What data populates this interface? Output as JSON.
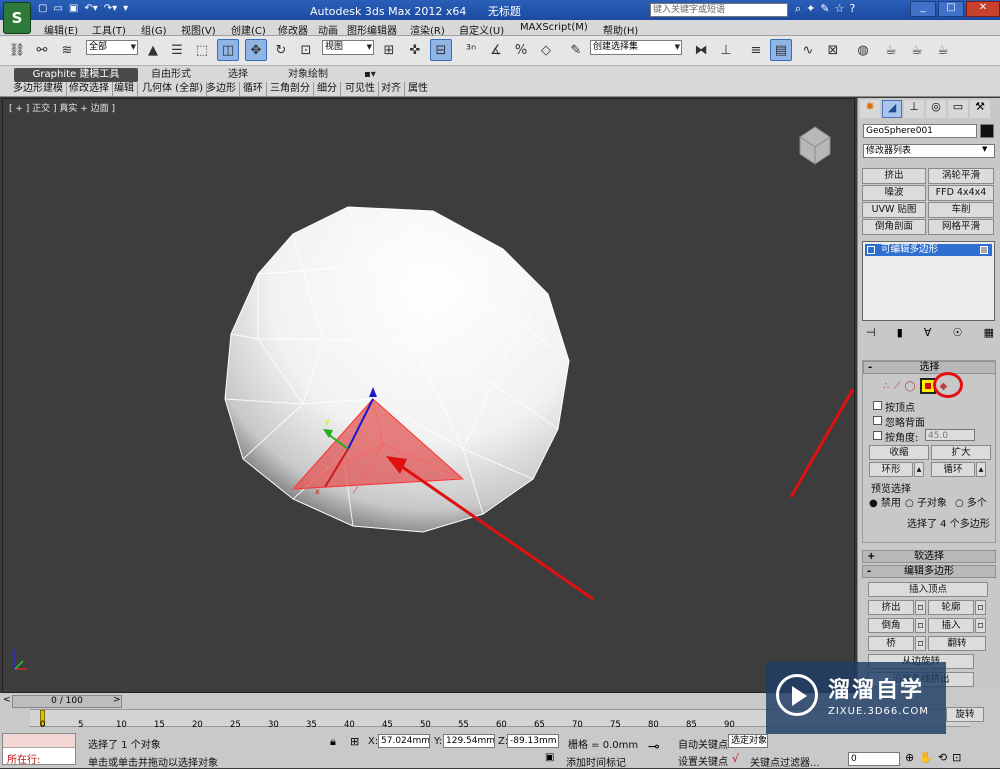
{
  "window": {
    "title": "Autodesk 3ds Max  2012 x64",
    "doc": "无标题",
    "search_placeholder": "键入关键字或短语"
  },
  "menu": [
    "编辑(E)",
    "工具(T)",
    "组(G)",
    "视图(V)",
    "创建(C)",
    "修改器",
    "动画",
    "图形编辑器",
    "渲染(R)",
    "自定义(U)",
    "MAXScript(M)",
    "帮助(H)"
  ],
  "toolbar": {
    "selection_filter": "全部",
    "ref_coord": "视图",
    "named_selection": "创建选择集"
  },
  "ribbon": {
    "tabs": [
      "Graphite 建模工具",
      "自由形式",
      "选择",
      "对象绘制"
    ],
    "subtabs": [
      "多边形建模",
      "修改选择",
      "编辑",
      "几何体 (全部)",
      "多边形",
      "循环",
      "三角剖分",
      "细分",
      "可见性",
      "对齐",
      "属性"
    ]
  },
  "viewport": {
    "label": "[ + ] 正交 ] 真实 + 边面 ]"
  },
  "command_panel": {
    "object_name": "GeoSphere001",
    "modifier_list": "修改器列表",
    "modifier_buttons": [
      [
        "挤出",
        "涡轮平滑"
      ],
      [
        "噪波",
        "FFD 4x4x4"
      ],
      [
        "UVW 贴图",
        "车削"
      ],
      [
        "倒角剖面",
        "网格平滑"
      ]
    ],
    "stack_item": "可编辑多边形",
    "selection_rollout": "选择",
    "by_vertex": "按顶点",
    "ignore_backfacing": "忽略背面",
    "by_angle": "按角度:",
    "angle_value": "45.0",
    "shrink": "收缩",
    "grow": "扩大",
    "ring": "环形",
    "loop": "循环",
    "preview_selection": "预览选择",
    "preview_options": [
      "禁用",
      "子对象",
      "多个"
    ],
    "selection_info": "选择了 4 个多边形",
    "soft_selection": "软选择",
    "edit_polygons": "编辑多边形",
    "insert_vertex": "插入顶点",
    "poly_buttons": [
      [
        "挤出",
        "轮廓"
      ],
      [
        "倒角",
        "插入"
      ],
      [
        "桥",
        "翻转"
      ]
    ],
    "hinge": "从边旋转",
    "extrude_spline": "沿样条线挤出",
    "edit_tri": "编辑三角剖分",
    "rotate": "旋转"
  },
  "timeline": {
    "frame_counter": "0 / 100",
    "ticks": [
      "0",
      "5",
      "10",
      "15",
      "20",
      "25",
      "30",
      "35",
      "40",
      "45",
      "50",
      "55",
      "60",
      "65",
      "70",
      "75",
      "80",
      "85",
      "90"
    ]
  },
  "status": {
    "mode": "所在行:",
    "selected": "选择了 1 个对象",
    "hint": "单击或单击并拖动以选择对象",
    "x_label": "X:",
    "x_value": "57.024mm",
    "y_label": "Y:",
    "y_value": "129.54mm",
    "z_label": "Z:",
    "z_value": "-89.13mm",
    "grid": "栅格 = 0.0mm",
    "auto_key": "自动关键点",
    "set_key": "设置关键点",
    "selected_obj": "选定对象",
    "add_time_tag": "添加时间标记",
    "key_filters": "关键点过滤器...",
    "frame_value": "0"
  },
  "watermark": {
    "brand": "溜溜自学",
    "url": "ZIXUE.3D66.COM"
  },
  "colors": {
    "annotation_red": "#e01010",
    "selection_highlight": "#ffee00",
    "stack_selected": "#2f6fd0"
  }
}
